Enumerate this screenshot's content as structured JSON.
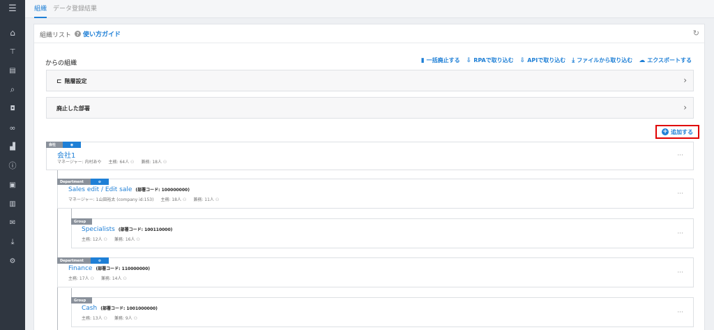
{
  "tabs": [
    {
      "label": "組織"
    },
    {
      "label": "データ登録結果"
    }
  ],
  "sidebar": {
    "items": [
      {
        "icon": "menu-icon",
        "glyph": "☰"
      },
      {
        "icon": "home-icon",
        "glyph": "⌂"
      },
      {
        "icon": "org-chart-icon",
        "glyph": "⊤"
      },
      {
        "icon": "document-icon",
        "glyph": "▤"
      },
      {
        "icon": "search-icon",
        "glyph": "⌕"
      },
      {
        "icon": "chat-icon",
        "glyph": "◘"
      },
      {
        "icon": "link-icon",
        "glyph": "∞"
      },
      {
        "icon": "chart-icon",
        "glyph": "▟"
      },
      {
        "icon": "info-icon",
        "glyph": "ⓘ"
      },
      {
        "icon": "contact-card-icon",
        "glyph": "▣"
      },
      {
        "icon": "book-icon",
        "glyph": "▥"
      },
      {
        "icon": "mail-icon",
        "glyph": "✉"
      },
      {
        "icon": "download-icon",
        "glyph": "⤓"
      },
      {
        "icon": "user-settings-icon",
        "glyph": "⚙"
      }
    ]
  },
  "panel": {
    "title": "組織リスト",
    "guide_label": "使い方ガイド",
    "help_glyph": "?",
    "refresh_glyph": "↻"
  },
  "org": {
    "title": "からの組織",
    "actions": [
      {
        "label": "一括廃止する",
        "icon": "trash-icon",
        "glyph": "▮"
      },
      {
        "label": "RPAで取り込む",
        "icon": "import-icon",
        "glyph": "⇩"
      },
      {
        "label": "APIで取り込む",
        "icon": "import-icon",
        "glyph": "⇩"
      },
      {
        "label": "ファイルから取り込む",
        "icon": "file-download-icon",
        "glyph": "⤓"
      },
      {
        "label": "エクスポートする",
        "icon": "cloud-download-icon",
        "glyph": "☁"
      }
    ]
  },
  "sections": [
    {
      "label": "階層設定",
      "icon": "hierarchy-icon",
      "glyph": "⊏"
    },
    {
      "label": "廃止した部署",
      "icon": "",
      "glyph": ""
    }
  ],
  "chevron_glyph": "›",
  "add_button": {
    "label": "追加する",
    "glyph": "+"
  },
  "more_glyph": "···",
  "eye_glyph": "◉",
  "eye_off_glyph": "⊘",
  "team_glyph": "⚇",
  "nodes": [
    {
      "badge": "会社",
      "name": "会社1",
      "code": "",
      "manager": "マネージャー: 内村あや",
      "primary": "主務: 64人",
      "secondary": "兼務: 18人"
    },
    {
      "badge": "Department",
      "name": "Sales edit / Edit sale",
      "code": "(部署コード: 100000000)",
      "manager": "マネージャー: 1山田裕太 (company id:153)",
      "primary": "主務: 18人",
      "secondary": "兼務: 11人"
    },
    {
      "badge": "Group",
      "name": "Specialists",
      "code": "(部署コード: 100110000)",
      "manager": "",
      "primary": "主務: 12人",
      "secondary": "兼務: 16人"
    },
    {
      "badge": "Department",
      "name": "Finance",
      "code": "(部署コード: 110000000)",
      "manager": "",
      "primary": "主務: 17人",
      "secondary": "兼務: 14人"
    },
    {
      "badge": "Group",
      "name": "Cash",
      "code": "(部署コード: 1001000000)",
      "manager": "",
      "primary": "主務: 13人",
      "secondary": "兼務: 9人"
    }
  ]
}
